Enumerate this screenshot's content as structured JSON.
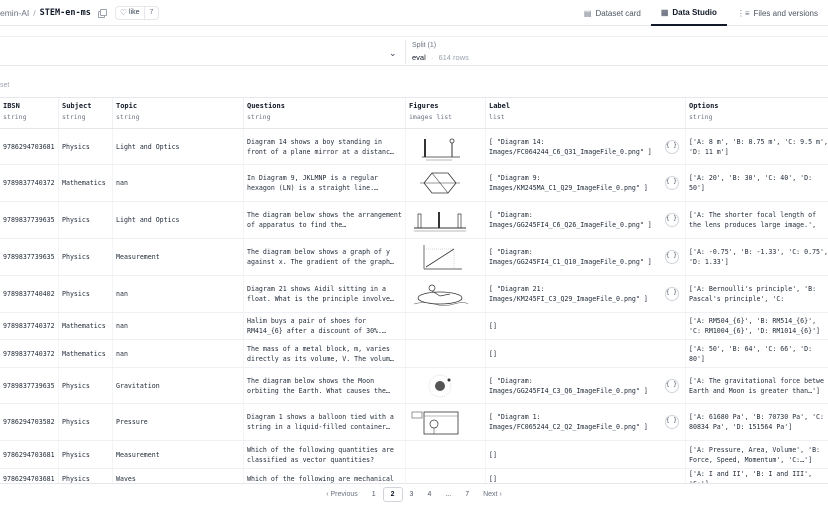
{
  "header": {
    "owner": "emin-AI",
    "dataset": "STEM-en-ms",
    "like_label": "like",
    "like_count": "7",
    "tabs": [
      {
        "label": "Dataset card",
        "icon": "card-icon",
        "active": false
      },
      {
        "label": "Data Studio",
        "icon": "table-icon",
        "active": true
      },
      {
        "label": "Files and versions",
        "icon": "files-icon",
        "active": false
      }
    ]
  },
  "split": {
    "title": "Split (1)",
    "value": "eval",
    "rows": "614 rows"
  },
  "subset_label": "set",
  "columns": [
    {
      "name": "IBSN",
      "type": "string"
    },
    {
      "name": "Subject",
      "type": "string"
    },
    {
      "name": "Topic",
      "type": "string"
    },
    {
      "name": "Questions",
      "type": "string"
    },
    {
      "name": "Figures",
      "type": "images list"
    },
    {
      "name": "Label",
      "type": "list"
    },
    {
      "name": "Options",
      "type": "string"
    }
  ],
  "rows": [
    {
      "ibsn": "9786294703681",
      "subject": "Physics",
      "topic": "Light and Optics",
      "question": "Diagram 14 shows a boy standing in front of a plane mirror at a distanc…",
      "figure": "mirror",
      "label": "[ \"Diagram 14: Images/FC064244_C6_Q31_ImageFile_0.png\" ]",
      "options": "['A: 8 m', 'B: 8.75 m', 'C: 9.5 m', 'D: 11 m']"
    },
    {
      "ibsn": "9789837740372",
      "subject": "Mathematics",
      "topic": "nan",
      "question": "In Diagram 9, JKLMNP is a regular hexagon (LN) is a straight line.…",
      "figure": "hexagon",
      "label": "[ \"Diagram 9: Images/KM245MA_C1_Q29_ImageFile_0.png\" ]",
      "options": "['A: 20', 'B: 30', 'C: 40', 'D: 50']"
    },
    {
      "ibsn": "9789837739635",
      "subject": "Physics",
      "topic": "Light and Optics",
      "question": "The diagram below shows the arrangement of apparatus to find the…",
      "figure": "apparatus",
      "label": "[ \"Diagram: Images/GG245FI4_C6_Q26_ImageFile_0.png\" ]",
      "options": "['A: The shorter focal length of the lens produces large image.', 'B: The']"
    },
    {
      "ibsn": "9789837739635",
      "subject": "Physics",
      "topic": "Measurement",
      "question": "The diagram below shows a graph of y against x. The gradient of the graph…",
      "figure": "graph",
      "label": "[ \"Diagram: Images/GG245FI4_C1_Q10_ImageFile_0.png\" ]",
      "options": "['A: -0.75', 'B: -1.33', 'C: 0.75', 'D: 1.33']"
    },
    {
      "ibsn": "9789837740402",
      "subject": "Physics",
      "topic": "nan",
      "question": "Diagram 21 shows Aidil sitting in a float. What is the principle involve…",
      "figure": "float",
      "label": "[ \"Diagram 21: Images/KM245FI_C3_Q29_ImageFile_0.png\" ]",
      "options": "['A: Bernoulli's principle', 'B: Pascal's principle', 'C: Archimede']"
    },
    {
      "ibsn": "9789837740372",
      "subject": "Mathematics",
      "topic": "nan",
      "question": "Halim buys a pair of shoes for RM414_{6} after a discount of 30%.…",
      "figure": "",
      "label": "[]",
      "options": "['A: RM504_{6}', 'B: RM514_{6}', 'C: RM1004_{6}', 'D: RM1014_{6}']"
    },
    {
      "ibsn": "9789837740372",
      "subject": "Mathematics",
      "topic": "nan",
      "question": "The mass of a metal block, m, varies directly as its volume, V. The volum…",
      "figure": "",
      "label": "[]",
      "options": "['A: 50', 'B: 64', 'C: 66', 'D: 80']"
    },
    {
      "ibsn": "9789837739635",
      "subject": "Physics",
      "topic": "Gravitation",
      "question": "The diagram below shows the Moon orbiting the Earth. What causes the…",
      "figure": "moon",
      "label": "[ \"Diagram: Images/GG245FI4_C3_Q6_ImageFile_0.png\" ]",
      "options": "['A: The gravitational force betwe Earth and Moon is greater than…']"
    },
    {
      "ibsn": "9786294703582",
      "subject": "Physics",
      "topic": "Pressure",
      "question": "Diagram 1 shows a balloon tied with a string in a liquid-filled container…",
      "figure": "balloon",
      "label": "[ \"Diagram 1: Images/FC065244_C2_Q2_ImageFile_0.png\" ]",
      "options": "['A: 61680 Pa', 'B: 70730 Pa', 'C: 80834 Pa', 'D: 151564 Pa']"
    },
    {
      "ibsn": "9786294703681",
      "subject": "Physics",
      "topic": "Measurement",
      "question": "Which of the following quantities are classified as vector quantities?",
      "figure": "",
      "label": "[]",
      "options": "['A: Pressure, Area, Volume', 'B: Force, Speed, Momentum', 'C:…']"
    },
    {
      "ibsn": "9786294703681",
      "subject": "Physics",
      "topic": "Waves",
      "question": "Which of the following are mechanical",
      "figure": "",
      "label": "[]",
      "options": "['A: I and II', 'B: I and III', 'C:']"
    }
  ],
  "pagination": {
    "previous": "‹ Previous",
    "pages": [
      "1",
      "2",
      "3",
      "4",
      "...",
      "7"
    ],
    "current": "2",
    "next": "Next ›"
  }
}
